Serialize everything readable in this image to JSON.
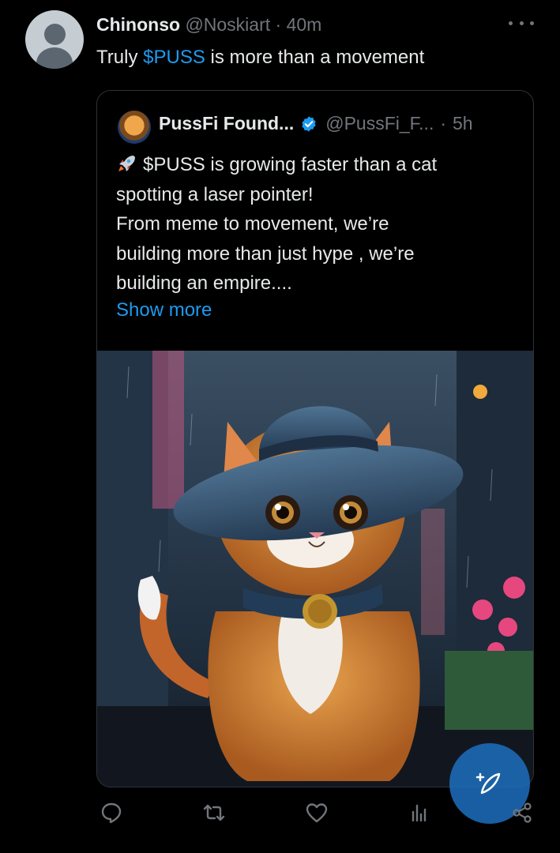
{
  "tweet": {
    "author_name": "Chinonso",
    "handle": "@Noskiart",
    "separator": "·",
    "time": "40m",
    "text_prefix": "Truly",
    "cashtag": "$PUSS",
    "text_suffix": "is more than a movement",
    "avatar_icon": "default-avatar-icon",
    "menu_icon": "more-options-icon"
  },
  "quote": {
    "name": "PussFi Found...",
    "handle": "@PussFi_F...",
    "separator": "·",
    "time": "5h",
    "verified_icon": "verified-badge-icon",
    "verified_color": "#1d9bf0",
    "lines": [
      "$PUSS is growing faster than a cat",
      "spotting a laser pointer!",
      "From meme to movement, we’re",
      "building more than just hype , we’re",
      "building an empire...."
    ],
    "leading_emoji": "rocket-icon",
    "show_more": "Show more",
    "image_description_icon": "cat-in-hat-image"
  },
  "actions": {
    "reply_icon": "reply-icon",
    "retweet_icon": "retweet-icon",
    "like_icon": "heart-icon",
    "views_icon": "views-chart-icon",
    "share_icon": "share-icon",
    "compose_icon": "compose-feather-icon"
  },
  "colors": {
    "background": "#000000",
    "text": "#e7e9ea",
    "muted": "#71767b",
    "accent": "#1d9bf0"
  }
}
